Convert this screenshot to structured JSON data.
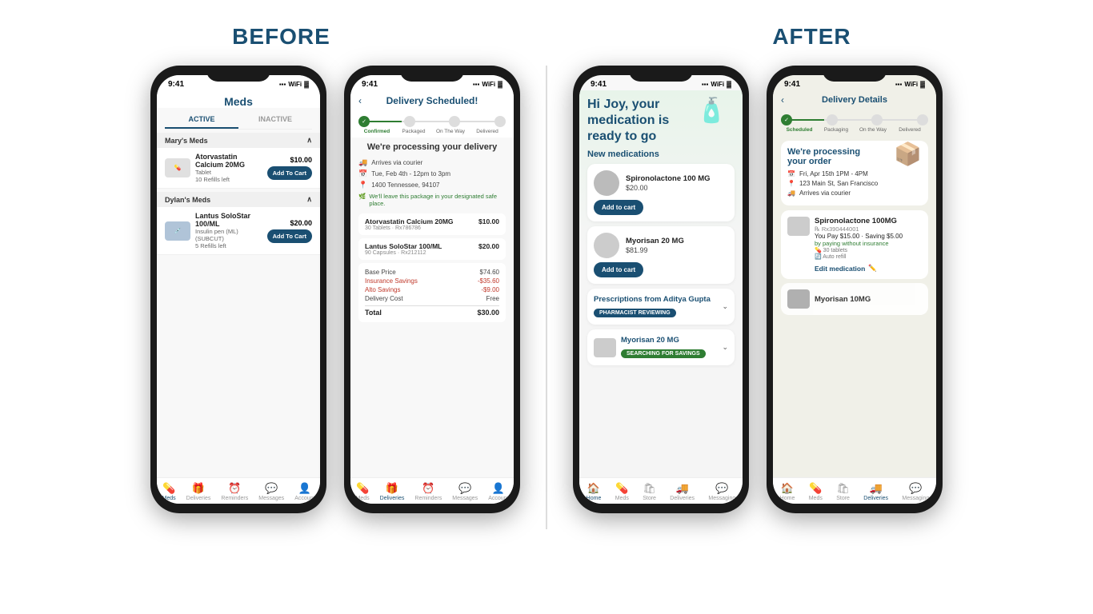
{
  "labels": {
    "before": "BEFORE",
    "after": "AFTER"
  },
  "screen1": {
    "status_time": "9:41",
    "title": "Meds",
    "tab_active": "ACTIVE",
    "tab_inactive": "INACTIVE",
    "section1": "Mary's Meds",
    "med1_name": "Atorvastatin Calcium 20MG",
    "med1_type": "Tablet",
    "med1_refills": "10 Refills left",
    "med1_price": "$10.00",
    "med1_btn": "Add To Cart",
    "section2": "Dylan's Meds",
    "med2_name": "Lantus SoloStar 100/ML",
    "med2_type": "Insulin pen (ML) (SUBCUT)",
    "med2_refills": "5 Refills left",
    "med2_price": "$20.00",
    "med2_btn": "Add To Cart",
    "nav": [
      "Meds",
      "Deliveries",
      "Reminders",
      "Messages",
      "Account"
    ]
  },
  "screen2": {
    "status_time": "9:41",
    "title": "Delivery Scheduled!",
    "steps": [
      "Confirmed",
      "Packaged",
      "On The Way",
      "Delivered"
    ],
    "body_title": "We're processing your delivery",
    "courier": "Arrives via courier",
    "date": "Tue, Feb 4th - 12pm to 3pm",
    "address": "1400 Tennessee, 94107",
    "safe_place": "We'll leave this package in your designated safe place.",
    "med1_name": "Atorvastatin Calcium 20MG",
    "med1_sub": "30 Tablets · Rx786786",
    "med1_price": "$10.00",
    "med2_name": "Lantus SoloStar 100/ML",
    "med2_sub": "90 Capsules · Rx212112",
    "med2_price": "$20.00",
    "base_price_label": "Base Price",
    "base_price": "$74.60",
    "insurance_label": "Insurance Savings",
    "insurance": "-$35.60",
    "alto_label": "Alto Savings",
    "alto": "-$9.00",
    "delivery_label": "Delivery Cost",
    "delivery": "Free",
    "total_label": "Total",
    "total": "$30.00",
    "nav": [
      "Meds",
      "Deliveries",
      "Reminders",
      "Messages",
      "Account"
    ]
  },
  "screen3": {
    "status_time": "9:41",
    "greeting": "Hi Joy, your medication is ready to go",
    "section": "New medications",
    "med1_name": "Spironolactone 100 MG",
    "med1_price": "$20.00",
    "med1_btn": "Add to cart",
    "med2_name": "Myorisan 20 MG",
    "med2_price": "$81.99",
    "med2_btn": "Add to cart",
    "rx1_title": "Prescriptions from Aditya Gupta",
    "rx1_status": "PHARMACIST REVIEWING",
    "rx2_name": "Myorisan 20 MG",
    "rx2_status": "SEARCHING FOR SAVINGS",
    "nav": [
      "Home",
      "Meds",
      "Store",
      "Deliveries",
      "Messaging"
    ]
  },
  "screen4": {
    "status_time": "9:41",
    "title": "Delivery Details",
    "steps": [
      "Scheduled",
      "Packaging",
      "On the Way",
      "Delivered"
    ],
    "body_title": "We're processing your order",
    "date": "Fri, Apr 15th 1PM - 4PM",
    "address": "123 Main St, San Francisco",
    "courier": "Arrives via courier",
    "med_name": "Spironolactone 100MG",
    "med_rx": "Rx390444001",
    "med_price": "You Pay $15.00 · Saving $5.00",
    "med_saving_sub": "by paying without insurance",
    "med_tablets": "30 tablets",
    "med_refill": "Auto refill",
    "edit_link": "Edit medication",
    "second_med": "Myorisan 10MG",
    "nav": [
      "Home",
      "Meds",
      "Store",
      "Deliveries",
      "Messaging"
    ]
  }
}
